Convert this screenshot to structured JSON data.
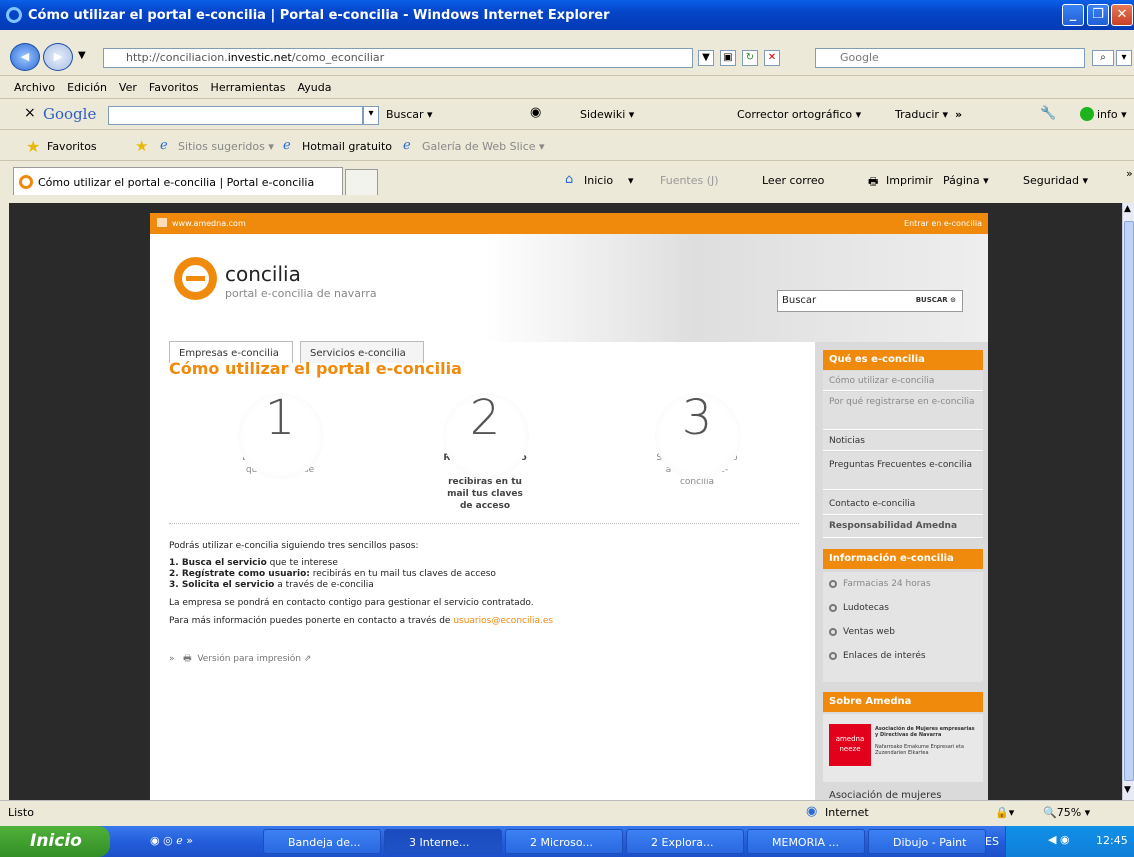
{
  "window": {
    "title": "Cómo utilizar el portal e-concilia | Portal e-concilia - Windows Internet Explorer"
  },
  "address": {
    "url_prefix": "http://conciliacion.",
    "url_domain": "investic.net",
    "url_path": "/como_econciliar",
    "search_placeholder": "Google"
  },
  "menu": [
    "Archivo",
    "Edición",
    "Ver",
    "Favoritos",
    "Herramientas",
    "Ayuda"
  ],
  "google_toolbar": {
    "close": "×",
    "logo": "Google",
    "buscar": "Buscar ▾",
    "sidewiki": "Sidewiki ▾",
    "corrector": "Corrector ortográfico ▾",
    "traducir": "Traducir ▾",
    "more": "»",
    "info": "info ▾"
  },
  "favorites": {
    "label": "Favoritos",
    "sitios": "Sitios sugeridos ▾",
    "hotmail": "Hotmail gratuito",
    "galeria": "Galería de Web Slice ▾"
  },
  "tab": {
    "title": "Cómo utilizar el portal e-concilia | Portal e-concilia"
  },
  "command_bar": {
    "inicio": "Inicio",
    "fuentes": "Fuentes (J)",
    "leer": "Leer correo",
    "imprimir": "Imprimir",
    "pagina": "Página ▾",
    "seguridad": "Seguridad ▾",
    "more": "»"
  },
  "site": {
    "topstrip_left": "www.amedna.com",
    "topstrip_right": "Entrar en e-concilia",
    "brand": "concilia",
    "brand_sub": "portal e-concilia de navarra",
    "search_value": "Buscar",
    "search_button": "BUSCAR ⊙",
    "tabs": [
      "Empresas e-concilia",
      "Servicios e-concilia"
    ],
    "title": "Cómo utilizar el portal e-concilia",
    "steps": [
      {
        "num": "1",
        "text": "Busca el servicio que te interese"
      },
      {
        "num": "2",
        "text": "Regístrate como usuario: recibirás en tu mail tus claves de acceso"
      },
      {
        "num": "3",
        "text": "Solicita el servicio a través de e-concilia"
      }
    ],
    "body": {
      "intro": "Podrás utilizar e-concilia siguiendo tres sencillos pasos:",
      "l1b": "1. Busca el servicio",
      "l1": " que te interese",
      "l2b": "2. Regístrate como usuario:",
      "l2": " recibirás en tu mail tus claves de acceso",
      "l3b": "3. Solicita el servicio",
      "l3": " a través de e-concilia",
      "contact": "La empresa se pondrá en contacto contigo para gestionar el servicio contratado.",
      "more": "Para más información puedes ponerte en contacto a través de ",
      "email": "usuarios@econcilia.es",
      "print": "Versión para impresión"
    },
    "side": {
      "h1": "Qué es e-concilia",
      "items": [
        "Cómo utilizar e-concilia",
        "Por qué registrarse en e-concilia",
        "Noticias",
        "Preguntas Frecuentes e-concilia",
        "Contacto e-concilia",
        "Responsabilidad Amedna"
      ],
      "h2": "Información e-concilia",
      "info": [
        "Farmacias 24 horas",
        "Ludotecas",
        "Ventas web",
        "Enlaces de interés"
      ],
      "h3": "Sobre Amedna",
      "amedna_logo": "amedna neeze",
      "amedna_text": "Asociación de Mujeres empresarias y Directivas de Navarra",
      "amedna_text2": "Nafarroako Emakume Enpresari eta Zuzendarien Elkartea",
      "asoc": "Asociación de mujeres"
    }
  },
  "status": {
    "text": "Listo",
    "zone": "Internet",
    "zoom": "75%"
  },
  "taskbar": {
    "start": "Inicio",
    "buttons": [
      "Bandeja de...",
      "3 Interne...",
      "2 Microso...",
      "2 Explora...",
      "MEMORIA ...",
      "Dibujo - Paint"
    ],
    "lang": "ES",
    "time": "12:45"
  }
}
